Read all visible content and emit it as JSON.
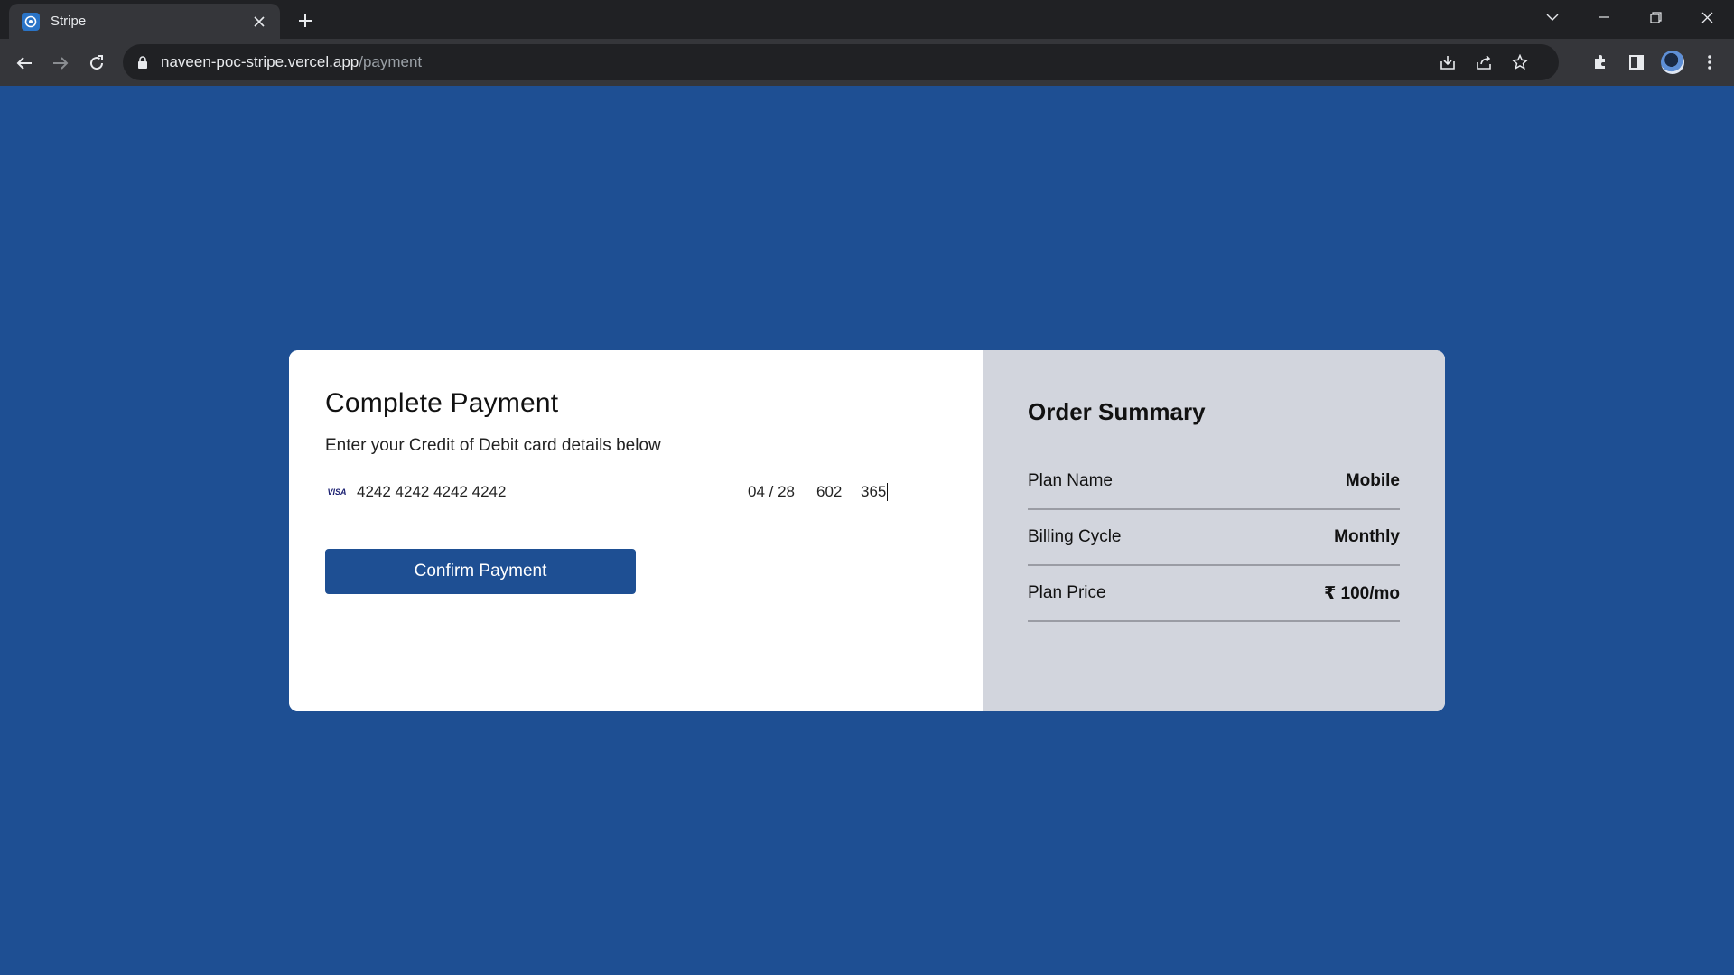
{
  "browser": {
    "tab_title": "Stripe",
    "url_host": "naveen-poc-stripe.vercel.app",
    "url_path": "/payment"
  },
  "payment": {
    "title": "Complete Payment",
    "subtitle": "Enter your Credit of Debit card details below",
    "card_brand": "VISA",
    "card_number": "4242 4242 4242 4242",
    "expiry": "04 / 28",
    "cvc": "602",
    "zip": "365",
    "confirm_label": "Confirm Payment"
  },
  "summary": {
    "title": "Order Summary",
    "rows": [
      {
        "label": "Plan Name",
        "value": "Mobile"
      },
      {
        "label": "Billing Cycle",
        "value": "Monthly"
      },
      {
        "label": "Plan Price",
        "value": "₹ 100/mo"
      }
    ]
  },
  "colors": {
    "page_background": "#1e4f93",
    "button": "#1e4f93",
    "summary_background": "#d2d5dd"
  }
}
